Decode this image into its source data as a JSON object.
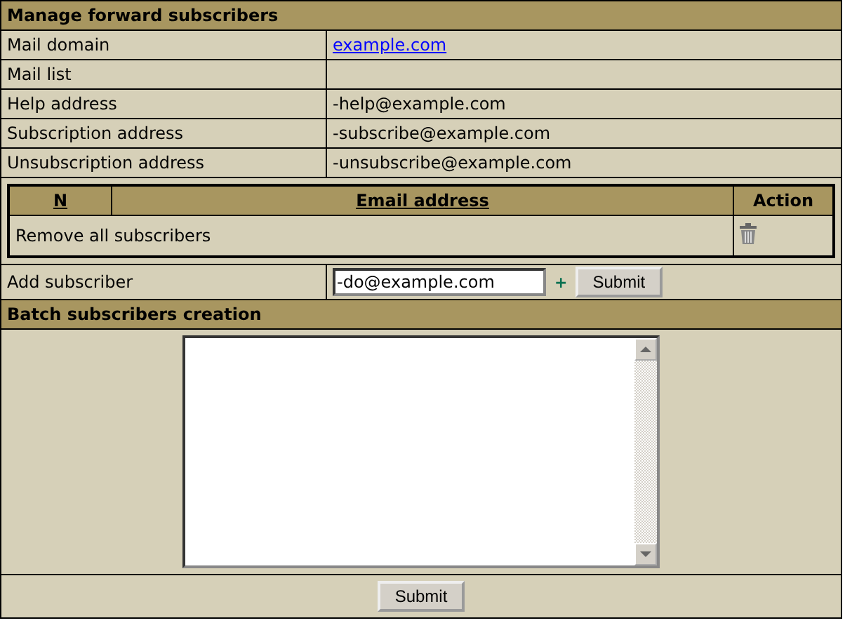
{
  "title": "Manage forward subscribers",
  "info_rows": [
    {
      "label": "Mail domain",
      "value": "example.com",
      "kind": "link"
    },
    {
      "label": "Mail list",
      "kind": "text"
    },
    {
      "label": "Help address",
      "value": "-help@example.com",
      "kind": "text"
    },
    {
      "label": "Subscription address",
      "value": "-subscribe@example.com",
      "kind": "text"
    },
    {
      "label": "Unsubscription address",
      "value": "-unsubscribe@example.com",
      "kind": "text"
    }
  ],
  "subscribers_table": {
    "columns": [
      {
        "label": "N",
        "sortable": true
      },
      {
        "label": "Email address",
        "sortable": true
      },
      {
        "label": "Action",
        "sortable": false
      }
    ],
    "remove_all": "Remove all subscribers"
  },
  "add_subscriber": {
    "label": "Add subscriber",
    "value": "-do@example.com",
    "add_mark": "+",
    "button": "Submit"
  },
  "batch": {
    "title": "Batch subscribers creation",
    "button": "Submit"
  }
}
